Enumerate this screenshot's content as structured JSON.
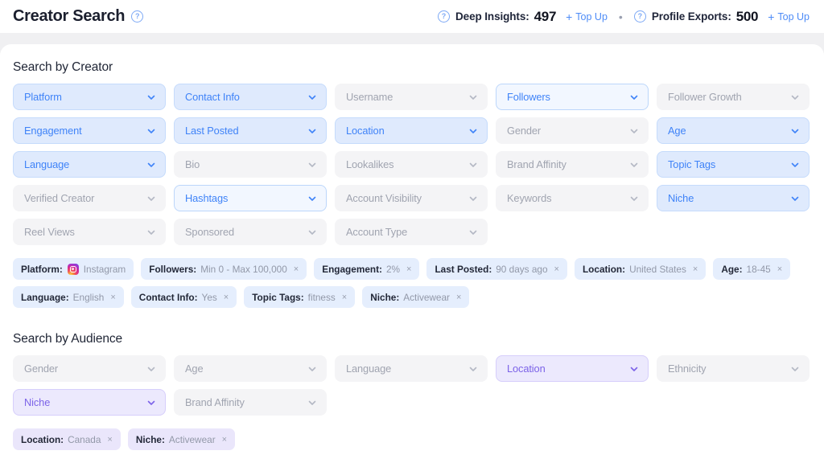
{
  "header": {
    "title": "Creator Search",
    "help_icon": "help-circle-icon",
    "deep_insights": {
      "label": "Deep Insights:",
      "value": "497",
      "topup": "Top Up",
      "plus": "+",
      "help_icon": "help-circle-icon"
    },
    "separator": "•",
    "profile_exports": {
      "label": "Profile Exports:",
      "value": "500",
      "topup": "Top Up",
      "plus": "+",
      "help_icon": "help-circle-icon"
    }
  },
  "creator": {
    "title": "Search by Creator",
    "filters": [
      {
        "label": "Platform",
        "state": "on"
      },
      {
        "label": "Contact Info",
        "state": "on"
      },
      {
        "label": "Username",
        "state": "off"
      },
      {
        "label": "Followers",
        "state": "on-light"
      },
      {
        "label": "Follower Growth",
        "state": "off"
      },
      {
        "label": "Engagement",
        "state": "on"
      },
      {
        "label": "Last Posted",
        "state": "on"
      },
      {
        "label": "Location",
        "state": "on"
      },
      {
        "label": "Gender",
        "state": "off"
      },
      {
        "label": "Age",
        "state": "on"
      },
      {
        "label": "Language",
        "state": "on"
      },
      {
        "label": "Bio",
        "state": "off"
      },
      {
        "label": "Lookalikes",
        "state": "off"
      },
      {
        "label": "Brand Affinity",
        "state": "off"
      },
      {
        "label": "Topic Tags",
        "state": "on"
      },
      {
        "label": "Verified Creator",
        "state": "off"
      },
      {
        "label": "Hashtags",
        "state": "on-light"
      },
      {
        "label": "Account Visibility",
        "state": "off"
      },
      {
        "label": "Keywords",
        "state": "off"
      },
      {
        "label": "Niche",
        "state": "on"
      },
      {
        "label": "Reel Views",
        "state": "off"
      },
      {
        "label": "Sponsored",
        "state": "off"
      },
      {
        "label": "Account Type",
        "state": "off"
      }
    ],
    "chips": [
      {
        "key": "Platform:",
        "value": "Instagram",
        "icon": "instagram-icon",
        "close": ""
      },
      {
        "key": "Followers:",
        "value": "Min 0 - Max 100,000",
        "icon": "",
        "close": "×"
      },
      {
        "key": "Engagement:",
        "value": "2%",
        "icon": "",
        "close": "×"
      },
      {
        "key": "Last Posted:",
        "value": "90 days ago",
        "icon": "",
        "close": "×"
      },
      {
        "key": "Location:",
        "value": "United States",
        "icon": "",
        "close": "×"
      },
      {
        "key": "Age:",
        "value": "18-45",
        "icon": "",
        "close": "×"
      },
      {
        "key": "Language:",
        "value": "English",
        "icon": "",
        "close": "×"
      },
      {
        "key": "Contact Info:",
        "value": "Yes",
        "icon": "",
        "close": "×"
      },
      {
        "key": "Topic Tags:",
        "value": "fitness",
        "icon": "",
        "close": "×"
      },
      {
        "key": "Niche:",
        "value": "Activewear",
        "icon": "",
        "close": "×"
      }
    ]
  },
  "audience": {
    "title": "Search by Audience",
    "filters": [
      {
        "label": "Gender",
        "state": "off"
      },
      {
        "label": "Age",
        "state": "off"
      },
      {
        "label": "Language",
        "state": "off"
      },
      {
        "label": "Location",
        "state": "on-purple"
      },
      {
        "label": "Ethnicity",
        "state": "off"
      },
      {
        "label": "Niche",
        "state": "on-purple"
      },
      {
        "label": "Brand Affinity",
        "state": "off"
      }
    ],
    "chips": [
      {
        "key": "Location:",
        "value": "Canada",
        "icon": "",
        "close": "×"
      },
      {
        "key": "Niche:",
        "value": "Activewear",
        "icon": "",
        "close": "×"
      }
    ]
  },
  "colors": {
    "accent_blue": "#3f83f8",
    "accent_purple": "#7c63e8",
    "chip_blue_bg": "#e5eefd",
    "chip_purple_bg": "#eae6fb",
    "inactive_bg": "#f4f4f6",
    "page_bg": "#f0f0f2"
  }
}
